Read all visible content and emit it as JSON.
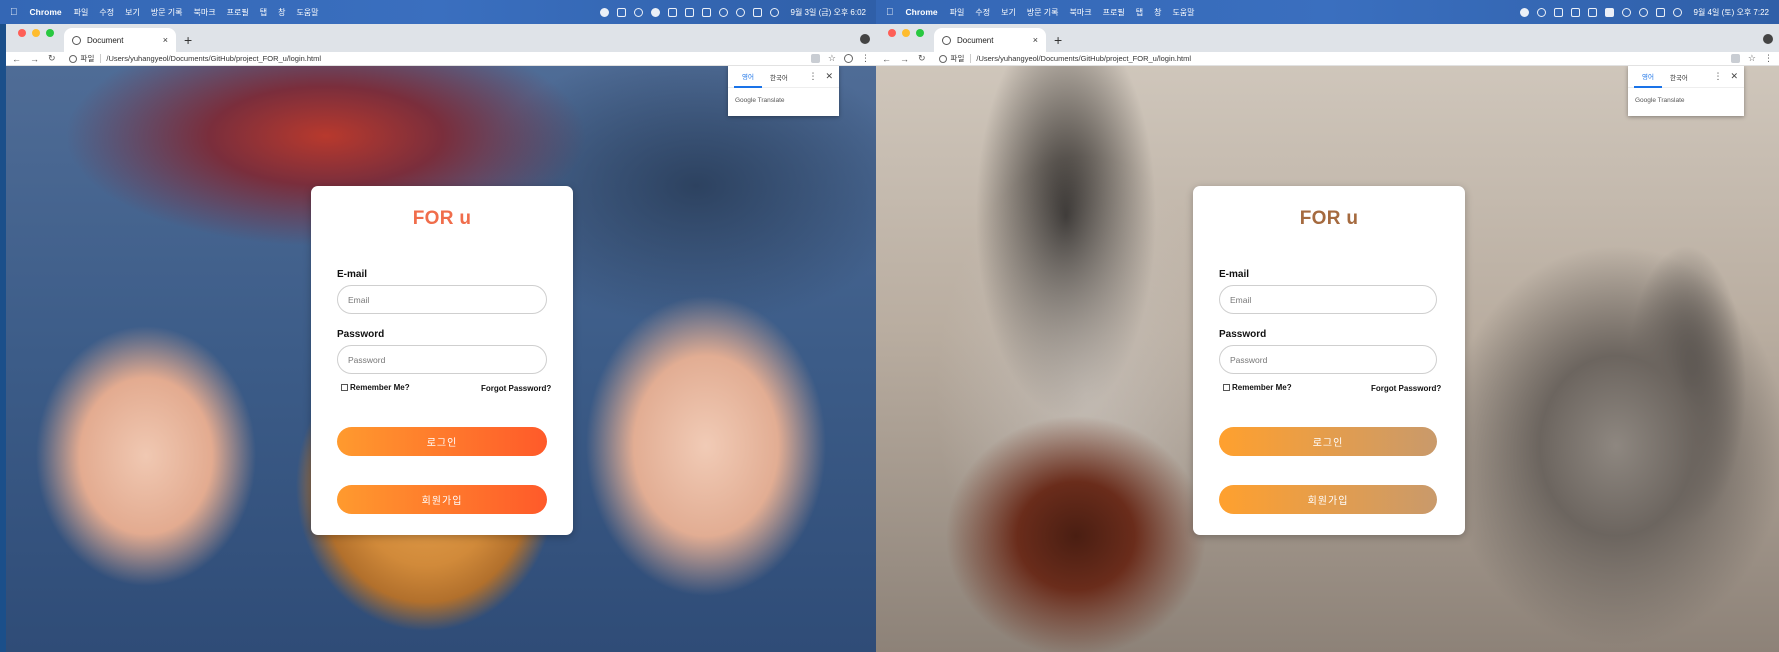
{
  "screens": [
    {
      "menubar": {
        "app": "Chrome",
        "items": [
          "파일",
          "수정",
          "보기",
          "방문 기록",
          "북마크",
          "프로필",
          "탭",
          "창",
          "도움말"
        ],
        "clock": "9월 3일 (금) 오후 6:02"
      },
      "tab": {
        "title": "Document",
        "close": "×",
        "new": "+"
      },
      "address": {
        "scheme": "파일",
        "url": "/Users/yuhangyeol/Documents/GitHub/project_FOR_u/login.html"
      },
      "translate": {
        "lang_en": "영어",
        "lang_ko": "한국어",
        "brand": "Google Translate"
      },
      "login": {
        "title": "FOR u",
        "email_label": "E-mail",
        "email_placeholder": "Email",
        "password_label": "Password",
        "password_placeholder": "Password",
        "remember": "Remember Me?",
        "forgot": "Forgot Password?",
        "login_btn": "로그인",
        "signup_btn": "회원가입"
      },
      "colors": {
        "title": "#f06d4b",
        "btn_start": "#ff9a2e",
        "btn_end": "#ff5a2a"
      }
    },
    {
      "menubar": {
        "app": "Chrome",
        "items": [
          "파일",
          "수정",
          "보기",
          "방문 기록",
          "북마크",
          "프로필",
          "탭",
          "창",
          "도움말"
        ],
        "clock": "9월 4일 (토) 오후 7:22"
      },
      "tab": {
        "title": "Document",
        "close": "×",
        "new": "+"
      },
      "address": {
        "scheme": "파일",
        "url": "/Users/yuhangyeol/Documents/GitHub/project_FOR_u/login.html"
      },
      "translate": {
        "lang_en": "영어",
        "lang_ko": "한국어",
        "brand": "Google Translate"
      },
      "login": {
        "title": "FOR u",
        "email_label": "E-mail",
        "email_placeholder": "Email",
        "password_label": "Password",
        "password_placeholder": "Password",
        "remember": "Remember Me?",
        "forgot": "Forgot Password?",
        "login_btn": "로그인",
        "signup_btn": "회원가입"
      },
      "colors": {
        "title": "#a56a3f",
        "btn_start": "#ffa02e",
        "btn_end": "#c99a6b"
      }
    }
  ]
}
